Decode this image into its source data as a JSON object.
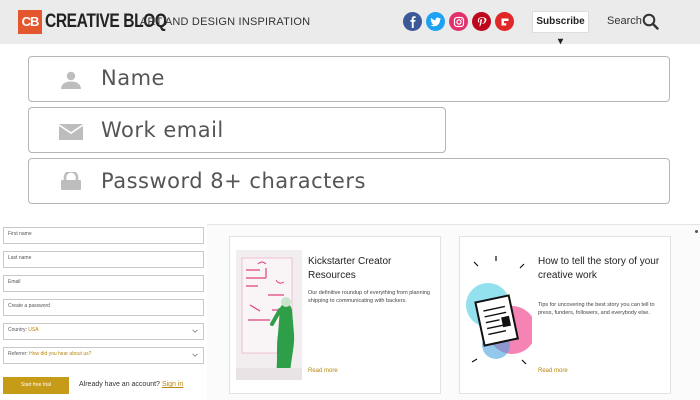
{
  "header": {
    "logo_mark": "CB",
    "logo_text": "CREATIVE BLOQ",
    "tagline": "ART AND DESIGN INSPIRATION",
    "social": [
      {
        "icon": "facebook-icon",
        "color": "#3b5998"
      },
      {
        "icon": "twitter-icon",
        "color": "#1da1f2"
      },
      {
        "icon": "instagram-icon",
        "color": "#e1306c"
      },
      {
        "icon": "pinterest-icon",
        "color": "#bd081c"
      },
      {
        "icon": "flipboard-icon",
        "color": "#e12828"
      }
    ],
    "subscribe_label": "Subscribe ▾",
    "search_label": "Search"
  },
  "signup_large": {
    "name_placeholder": "Name",
    "email_placeholder": "Work email",
    "password_placeholder": "Password 8+ characters"
  },
  "signup_small": {
    "first_name": "First name",
    "last_name": "Last name",
    "email": "Email",
    "password": "Create a password",
    "country_label": "Country: ",
    "country_value": "USA",
    "referrer_label": "Referrer: ",
    "referrer_value": "How did you hear about us?",
    "start_button": "Start free trial",
    "already_text": "Already have an account?",
    "sign_in": "Sign in"
  },
  "articles": [
    {
      "title": "Kickstarter Creator Resources",
      "description": "Our definitive roundup of everything from planning shipping to communicating with backers.",
      "read_more": "Read more"
    },
    {
      "title": "How to tell the story of your creative work",
      "description": "Tips for uncovering the best story you can tell to press, funders, followers, and everybody else.",
      "read_more": "Read more"
    }
  ],
  "colors": {
    "accent": "#e4572e",
    "link": "#b8860b",
    "button": "#c69b18"
  }
}
